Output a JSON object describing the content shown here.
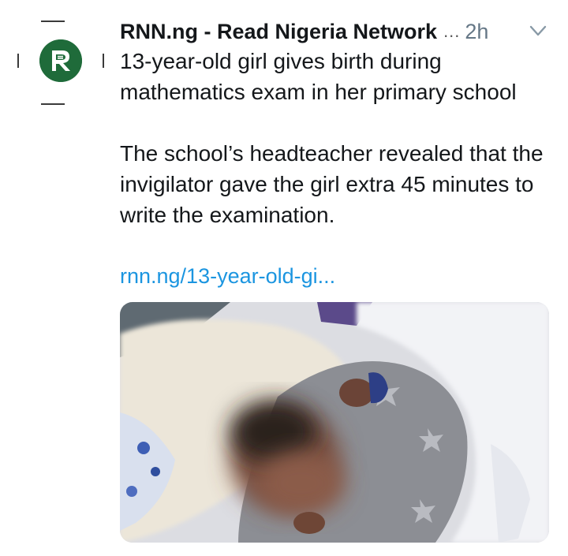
{
  "tweet": {
    "author_name": "RNN.ng - Read Nigeria Network",
    "more_indicator": "...",
    "time": "2h",
    "text_lines_1": "13-year-old girl gives birth during mathematics exam in her primary school",
    "text_lines_2": "The school’s headteacher revealed that the invigilator gave the girl extra 45 minutes to write the examination.",
    "link_text": "rnn.ng/13-year-old-gi...",
    "media_kind": "photo",
    "avatar_icon": "rnn-logo-icon",
    "caret_icon": "chevron-down-icon"
  },
  "colors": {
    "link": "#1b95e0",
    "muted": "#657786",
    "avatar_bg": "#1f6b3a"
  }
}
